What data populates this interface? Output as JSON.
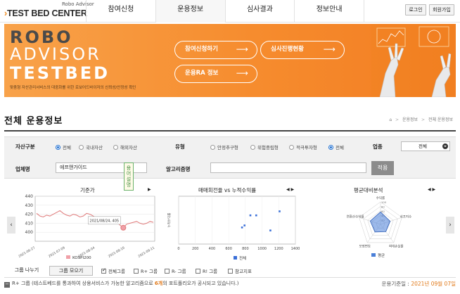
{
  "header": {
    "logo_small": "Robo Advisor",
    "logo_chevron": "›",
    "logo_big": "TEST BED CENTER",
    "nav": [
      "참여신청",
      "운용정보",
      "심사결과",
      "정보안내"
    ],
    "active_nav": 1,
    "login_label": "로그인",
    "signup_label": "회원가입"
  },
  "banner": {
    "line1": "ROBO",
    "line2": "ADVISOR",
    "line3": "TESTBED",
    "caption": "맞춤형 자산관리서비스의 대중화를 위한   로보어드바이저의 신뢰성/안정성 확인",
    "buttons": [
      "참여신청하기",
      "심사진행현황",
      "운용RA 정보"
    ],
    "arrow": "⟶"
  },
  "page": {
    "title": "전체 운용정보",
    "breadcrumb": [
      "운용정보",
      "전체 운용정보"
    ],
    "home_icon": "home-icon",
    "separator": ">"
  },
  "filters": {
    "asset_label": "자산구분",
    "asset_options": [
      "전체",
      "국내자산",
      "해외자산"
    ],
    "asset_selected": 0,
    "type_label": "유형",
    "type_options": [
      "안정추구형",
      "위험중립형",
      "적극투자형",
      "전체"
    ],
    "type_selected": 3,
    "industry_label": "업종",
    "industry_value": "전체",
    "company_label": "업체명",
    "company_value": "에프앤가이드",
    "algo_label": "알고리즘명",
    "algo_value": "",
    "apply_label": "적용",
    "tooltip_text": "용어설명"
  },
  "charts": {
    "left_arrow": "‹",
    "right_arrow": "›",
    "line_title": "기준가",
    "line_nav": "▶",
    "scatter_title": "매매회전율 vs 누적수익률",
    "scatter_nav": "◀ ▶",
    "radar_title": "평균대비분석",
    "radar_nav": "◀ ▶"
  },
  "chart_data": [
    {
      "type": "line",
      "title": "기준가",
      "x": [
        "2021-06-27",
        "2021-07-09",
        "2021-08-04",
        "2021-08-16",
        "2021-09-11"
      ],
      "ylim": [
        390,
        440
      ],
      "yticks": [
        400,
        410,
        420,
        430,
        440
      ],
      "series": [
        {
          "name": "KOSPI200",
          "values": [
            421,
            418,
            417,
            419,
            418,
            420,
            422,
            424,
            421,
            419,
            418,
            420,
            419,
            417,
            418,
            421,
            420,
            418,
            416,
            417,
            415,
            417,
            416,
            413,
            411,
            408,
            405,
            409,
            410,
            411,
            412,
            410,
            409,
            410,
            412,
            411
          ]
        }
      ],
      "tooltip": "2021/08/24, 405",
      "color": "#e07a7a"
    },
    {
      "type": "scatter",
      "title": "매매회전율 vs 누적수익률",
      "xlim": [
        0,
        1400
      ],
      "xticks": [
        0,
        200,
        400,
        600,
        800,
        1000,
        1200,
        1400
      ],
      "ylim": [
        -5,
        90
      ],
      "ylabel": "누적수익률",
      "series": [
        {
          "name": "전체",
          "points": [
            [
              760,
              28
            ],
            [
              790,
              32
            ],
            [
              860,
              52
            ],
            [
              930,
              52
            ],
            [
              1100,
              22
            ],
            [
              1210,
              60
            ]
          ]
        }
      ],
      "color": "#3a6fd8"
    },
    {
      "type": "radar",
      "title": "평균대비분석",
      "axes": [
        "수익률",
        "샤프지수",
        "최대손실률",
        "보정변동",
        "연환산수익률"
      ],
      "ticks": [
        20,
        40,
        60,
        80,
        100
      ],
      "series": [
        {
          "name": "평균",
          "values": [
            55,
            45,
            40,
            42,
            48
          ]
        }
      ],
      "color": "#4a7fd8"
    }
  ],
  "controls": {
    "group_view": "그룹 나누기",
    "group_show": "그룹 모으기",
    "checks": [
      {
        "label": "전체그룹",
        "checked": true
      },
      {
        "label": "R+ 그룹",
        "checked": false
      },
      {
        "label": "R- 그룹",
        "checked": false
      },
      {
        "label": "R! 그룹",
        "checked": false
      },
      {
        "label": "참고지표",
        "checked": false
      }
    ]
  },
  "footer": {
    "minus": "−",
    "legend_prefix": "R+ 그룹 (테스트베드를 통과하여 상용서비스가 가능한 알고리즘으로 ",
    "legend_count": "6개",
    "legend_suffix": "의 포트폴리오가 공시되고 있습니다.)",
    "ref_label": "운용기준일 : ",
    "ref_date": "2021년 09월 07일"
  }
}
